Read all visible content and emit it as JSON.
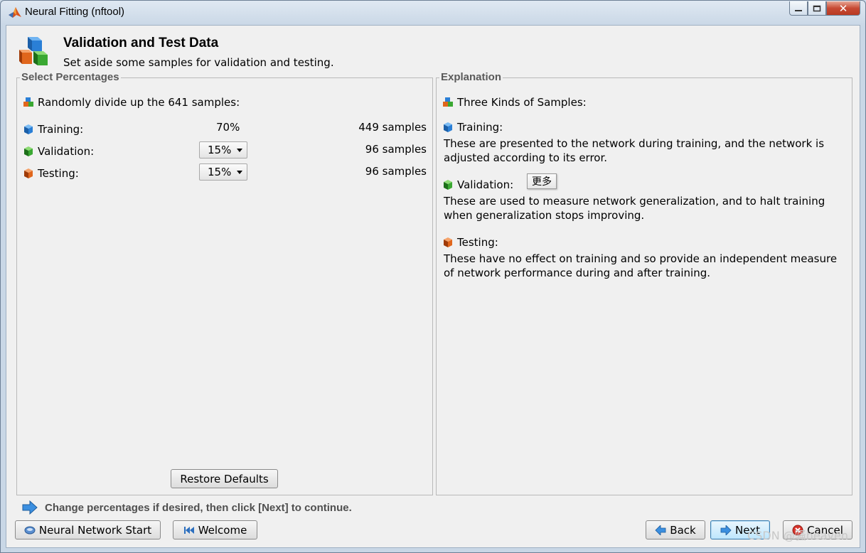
{
  "window": {
    "title": "Neural Fitting (nftool)",
    "minimize_label": "_",
    "maximize_label": "□",
    "close_label": "✕"
  },
  "header": {
    "title": "Validation and Test Data",
    "subtitle": "Set aside some samples for validation and testing."
  },
  "select_panel": {
    "legend": "Select Percentages",
    "intro": "Randomly divide up the 641 samples:",
    "rows": [
      {
        "label": "Training:",
        "percent": "70%",
        "samples": "449 samples"
      },
      {
        "label": "Validation:",
        "percent": "15%",
        "samples": "96 samples"
      },
      {
        "label": "Testing:",
        "percent": "15%",
        "samples": "96 samples"
      }
    ],
    "restore_label": "Restore Defaults"
  },
  "explanation_panel": {
    "legend": "Explanation",
    "intro": "Three Kinds of Samples:",
    "training_heading": "Training:",
    "training_text": "These are presented to the network during training, and the network is adjusted according to its error.",
    "validation_heading": "Validation:",
    "more_label": "更多",
    "validation_text": "These are used to measure network generalization, and to halt training when generalization stops improving.",
    "testing_heading": "Testing:",
    "testing_text": "These have no effect on training and so provide an independent measure of network performance during and after training."
  },
  "hint": "Change percentages if desired, then click [Next] to continue.",
  "footer": {
    "start_label": "Neural Network Start",
    "welcome_label": "Welcome",
    "back_label": "Back",
    "next_label": "Next",
    "cancel_label": "Cancel"
  },
  "watermark": "CSDN @骚heaven",
  "colors": {
    "training_cube": "#2a7fd6",
    "validation_cube": "#2e9e2a",
    "testing_cube": "#e0661c"
  }
}
